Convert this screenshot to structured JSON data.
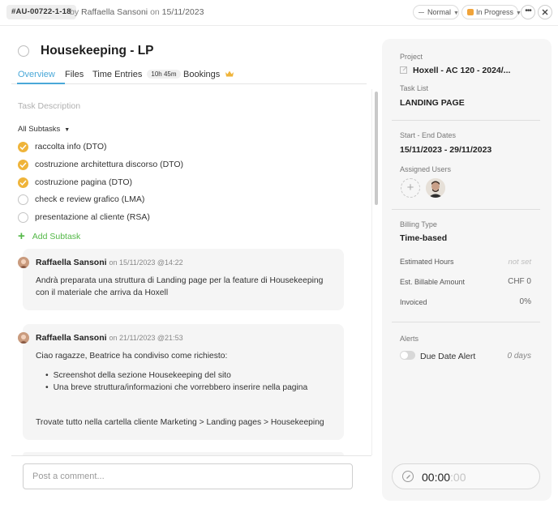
{
  "header": {
    "task_id": "#AU-00722-1-18",
    "by_prefix": "by",
    "author": "Raffaella Sansoni",
    "on_prefix": "on",
    "created_date": "15/11/2023",
    "priority": "Normal",
    "status": "In Progress",
    "status_color": "#f0a33a"
  },
  "task": {
    "title": "Housekeeping - LP",
    "description_placeholder": "Task Description"
  },
  "tabs": [
    {
      "label": "Overview",
      "active": true
    },
    {
      "label": "Files"
    },
    {
      "label": "Time Entries",
      "badge": "10h 45m"
    },
    {
      "label": "Bookings",
      "icon": "crown-icon"
    }
  ],
  "subtasks": {
    "filter_label": "All Subtasks",
    "items": [
      {
        "label": "raccolta info (DTO)",
        "done": true
      },
      {
        "label": "costruzione architettura discorso (DTO)",
        "done": true
      },
      {
        "label": "costruzione pagina (DTO)",
        "done": true
      },
      {
        "label": "check e review grafico (LMA)",
        "done": false
      },
      {
        "label": "presentazione al cliente (RSA)",
        "done": false
      }
    ],
    "add_label": "Add Subtask"
  },
  "comments": [
    {
      "author": "Raffaella Sansoni",
      "date": "on 15/11/2023 @14:22",
      "lines": [
        "Andrà preparata una struttura di Landing page per la feature di Housekeeping",
        "con il materiale che arriva da Hoxell"
      ]
    },
    {
      "author": "Raffaella Sansoni",
      "date": "on 21/11/2023 @21:53",
      "intro": "Ciao ragazze, Beatrice ha condiviso come richiesto:",
      "bullets": [
        "Screenshot della sezione Housekeeping del sito",
        "Una breve struttura/informazioni che vorrebbero inserire nella pagina"
      ],
      "outro": "Trovate tutto nella cartella cliente Marketing > Landing pages > Housekeeping"
    }
  ],
  "comment_input": {
    "placeholder": "Post a comment..."
  },
  "details": {
    "project_label": "Project",
    "project_value": "Hoxell - AC 120 - 2024/...",
    "tasklist_label": "Task List",
    "tasklist_value": "LANDING PAGE",
    "dates_label": "Start - End Dates",
    "dates_value": "15/11/2023 - 29/11/2023",
    "users_label": "Assigned Users",
    "billing_label": "Billing Type",
    "billing_value": "Time-based",
    "estimated_hours_label": "Estimated Hours",
    "estimated_hours_value": "not set",
    "billable_label": "Est. Billable Amount",
    "billable_value": "CHF 0",
    "invoiced_label": "Invoiced",
    "invoiced_value": "0%",
    "alerts_label": "Alerts",
    "due_alert_label": "Due Date Alert",
    "due_alert_value": "0 days"
  },
  "timer": {
    "hm": "00:00",
    "sec": ":00"
  }
}
